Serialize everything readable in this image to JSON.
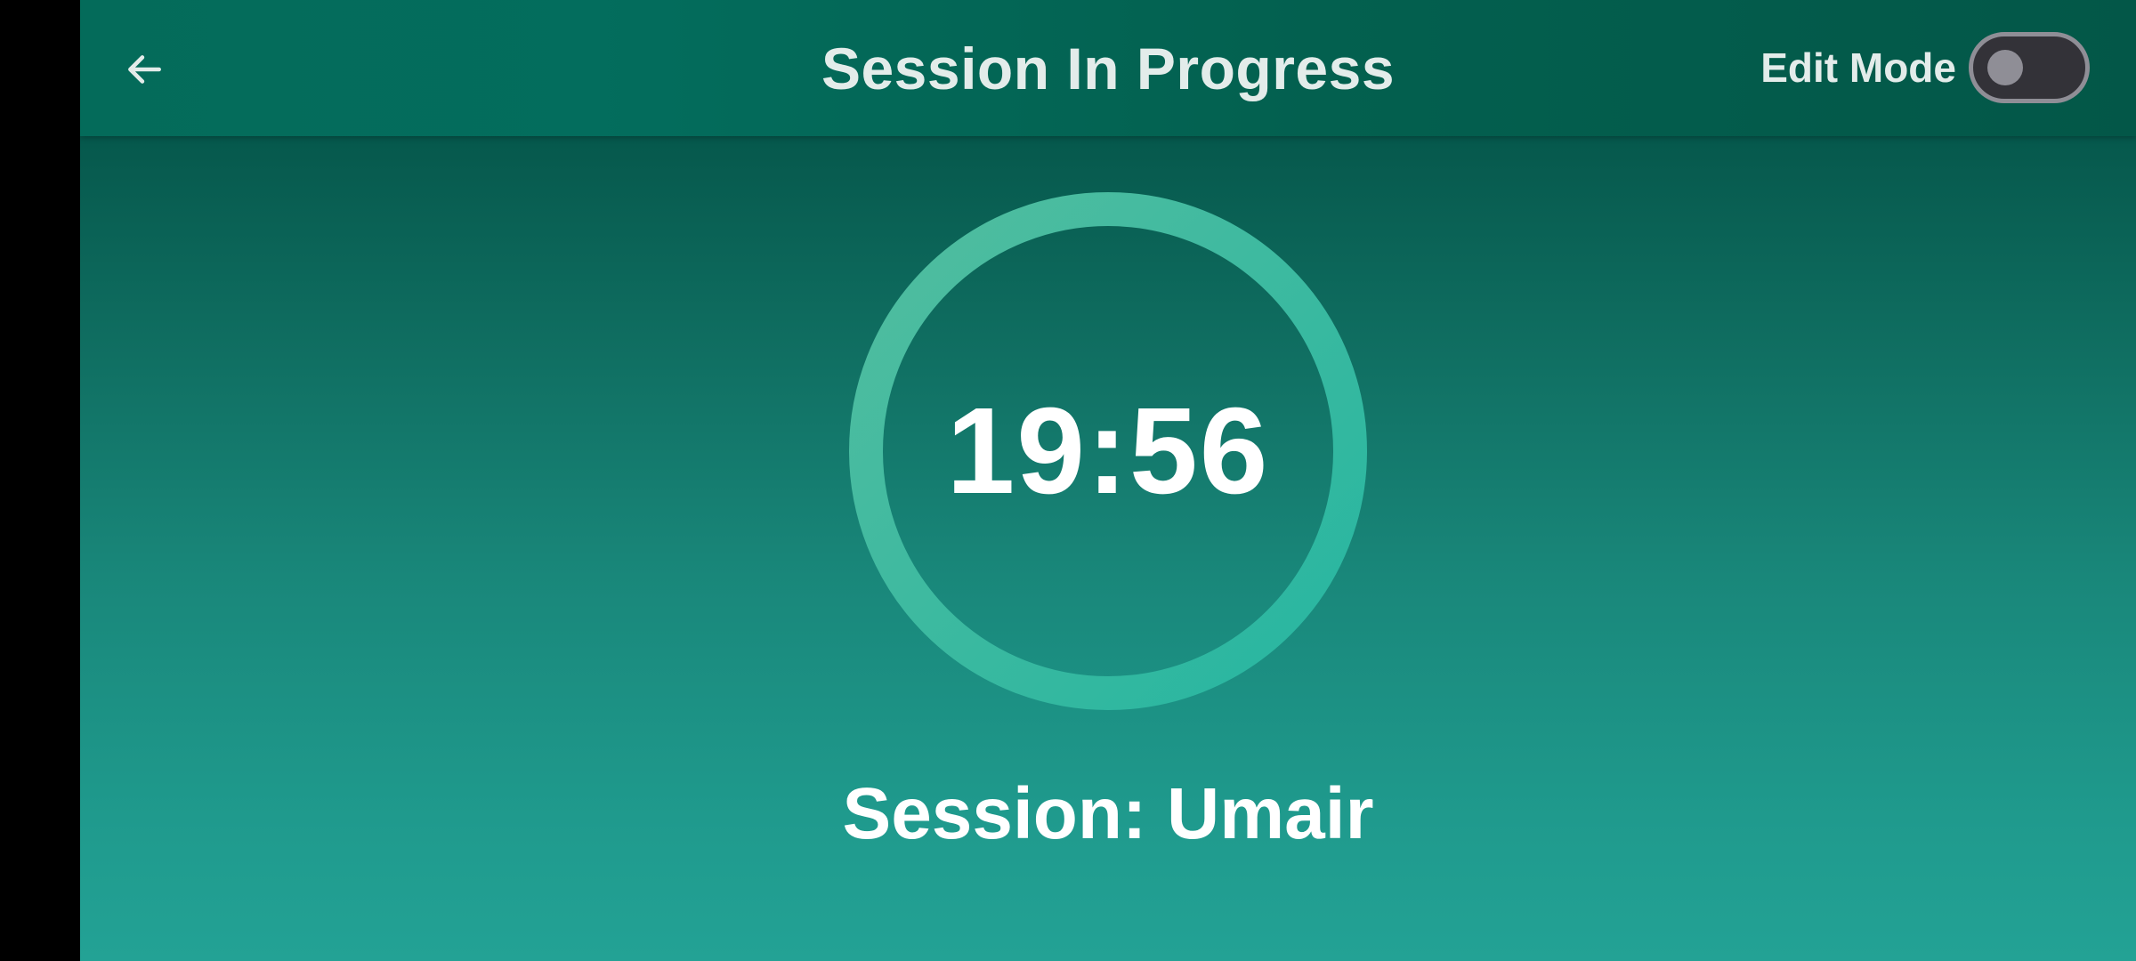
{
  "header": {
    "title": "Session In Progress",
    "back_icon": "arrow-left-icon",
    "edit_mode_label": "Edit Mode",
    "edit_mode_enabled": false
  },
  "timer": {
    "time": "19:56",
    "ring_color": "#3dbfa5"
  },
  "session": {
    "label": "Session: Umair"
  },
  "colors": {
    "app_bar": "#036d5d",
    "background_top": "#02523f",
    "background_bottom": "#23a295",
    "text": "#ffffff",
    "toggle_track": "#333238",
    "toggle_border": "#8f8e96"
  }
}
